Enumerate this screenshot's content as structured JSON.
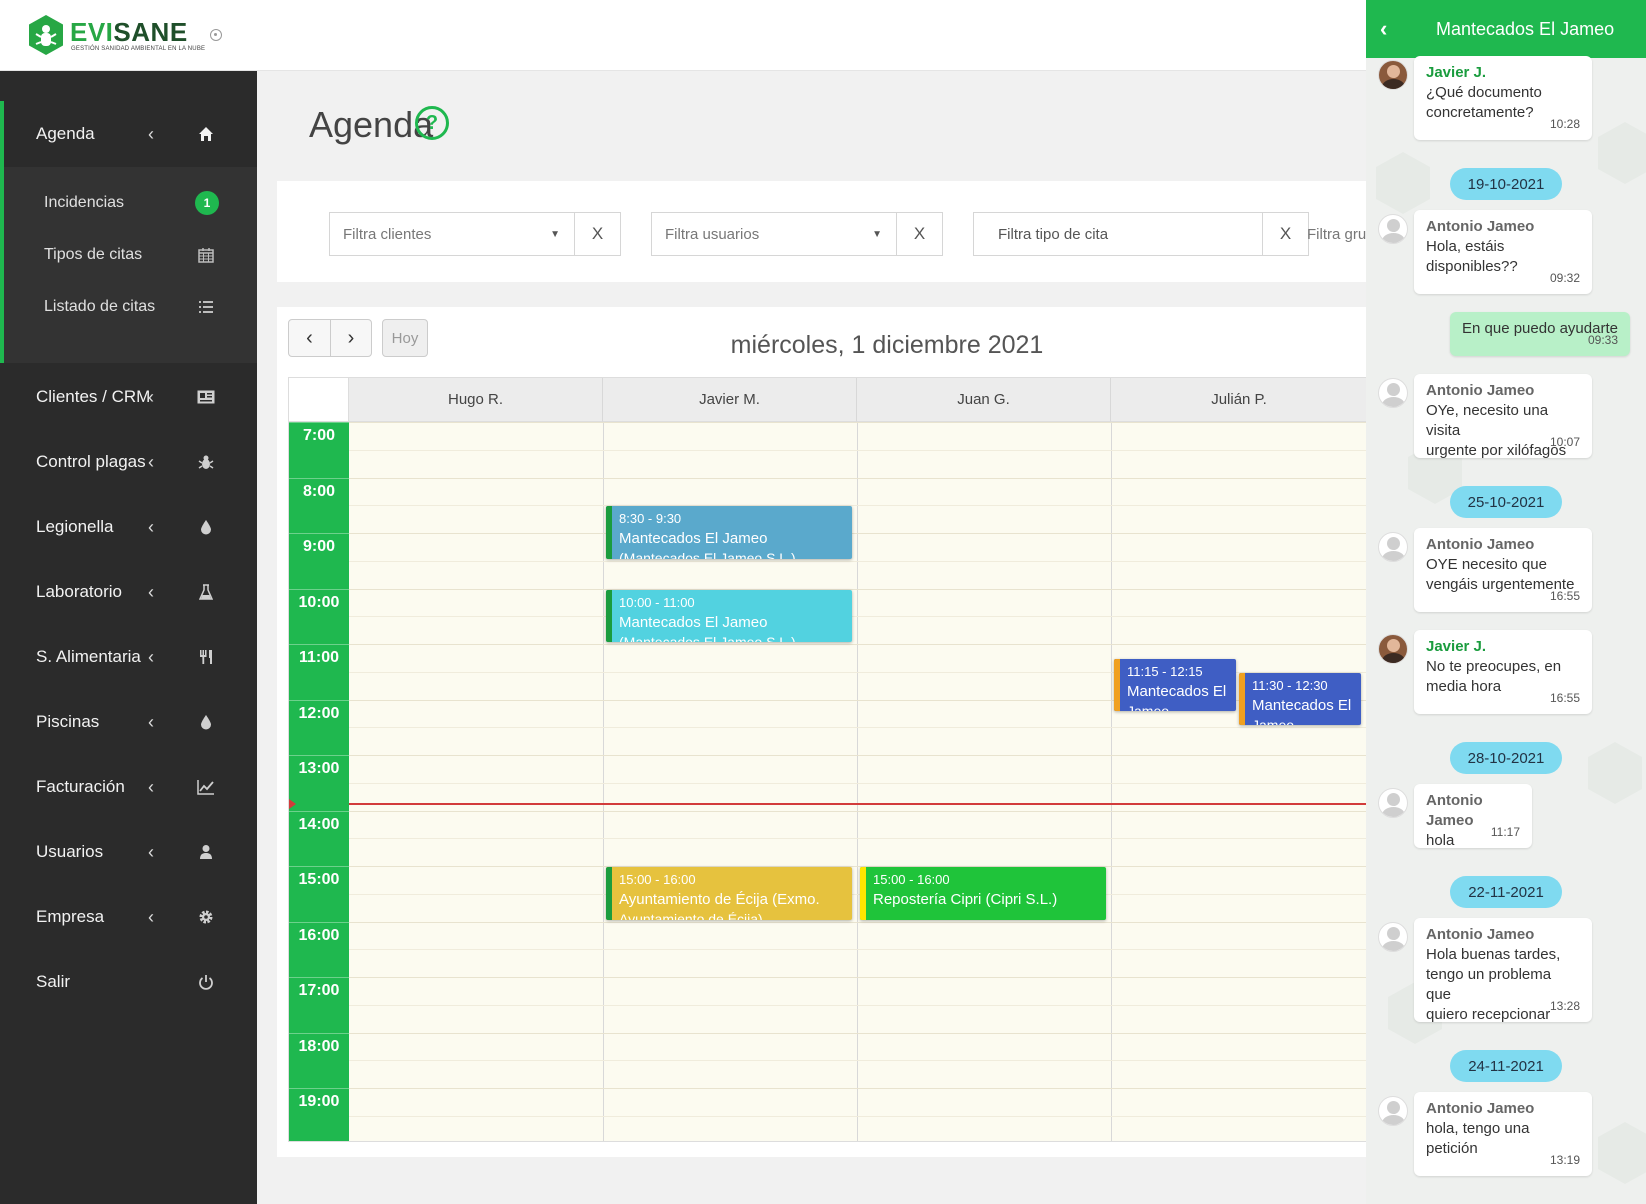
{
  "brand": {
    "name_a": "EVI",
    "name_b": "SANE",
    "tagline": "GESTIÓN SANIDAD AMBIENTAL EN LA NUBE",
    "color": "#27a745"
  },
  "sidebar": {
    "active": {
      "label": "Agenda",
      "chevron": "‹",
      "icon": "home-icon"
    },
    "sub_items": [
      {
        "label": "Incidencias",
        "badge": "1"
      },
      {
        "label": "Tipos de citas",
        "icon": "calendar-icon"
      },
      {
        "label": "Listado de citas",
        "icon": "list-icon"
      }
    ],
    "items": [
      {
        "label": "Clientes / CRM",
        "icon": "id-card-icon"
      },
      {
        "label": "Control plagas",
        "icon": "bug-icon"
      },
      {
        "label": "Legionella",
        "icon": "drop-icon"
      },
      {
        "label": "Laboratorio",
        "icon": "flask-icon"
      },
      {
        "label": "S. Alimentaria",
        "icon": "utensils-icon"
      },
      {
        "label": "Piscinas",
        "icon": "drop-icon"
      },
      {
        "label": "Facturación",
        "icon": "chart-icon"
      },
      {
        "label": "Usuarios",
        "icon": "user-icon"
      },
      {
        "label": "Empresa",
        "icon": "gear-icon"
      },
      {
        "label": "Salir",
        "icon": "power-icon"
      }
    ],
    "chevron": "‹"
  },
  "page": {
    "title": "Agenda",
    "help": "?"
  },
  "filters": {
    "clients_placeholder": "Filtra clientes",
    "users_placeholder": "Filtra usuarios",
    "type_placeholder": "Filtra tipo de cita",
    "group_placeholder": "Filtra gru",
    "clear": "X"
  },
  "calendar": {
    "prev": "‹",
    "next": "›",
    "today": "Hoy",
    "title": "miércoles, 1 diciembre 2021",
    "columns": [
      "Hugo R.",
      "Javier M.",
      "Juan G.",
      "Julián P."
    ],
    "hours": [
      "7:00",
      "8:00",
      "9:00",
      "10:00",
      "11:00",
      "12:00",
      "13:00",
      "14:00",
      "15:00",
      "16:00",
      "17:00",
      "18:00",
      "19:00"
    ],
    "events": [
      {
        "col": 1,
        "start": 8.5,
        "end": 9.5,
        "time": "8:30 - 9:30",
        "title": "Mantecados El Jameo",
        "sub": "(Mantecados El Jameo S.L.)",
        "color": "#5aa9cc",
        "bar": "#1a9c3e"
      },
      {
        "col": 1,
        "start": 10,
        "end": 11,
        "time": "10:00 - 11:00",
        "title": "Mantecados El Jameo",
        "sub": "(Mantecados El Jameo S.L.)",
        "color": "#52d2e0",
        "bar": "#1a9c3e"
      },
      {
        "col": 3,
        "start": 11.25,
        "end": 12.25,
        "time": "11:15 - 12:15",
        "title": "Mantecados El",
        "sub": "Jameo",
        "color": "#3f5ec4",
        "bar": "#f0a020",
        "half": 0
      },
      {
        "col": 3,
        "start": 11.5,
        "end": 12.5,
        "time": "11:30 - 12:30",
        "title": "Mantecados El",
        "sub": "Jameo",
        "color": "#3f5ec4",
        "bar": "#f0a020",
        "half": 1
      },
      {
        "col": 1,
        "start": 15,
        "end": 16,
        "time": "15:00 - 16:00",
        "title": "Ayuntamiento de Écija (Exmo.",
        "sub": "Ayuntamiento de Écija)",
        "color": "#e6c23e",
        "bar": "#1a9c3e"
      },
      {
        "col": 2,
        "start": 15,
        "end": 16,
        "time": "15:00 - 16:00",
        "title": "Repostería Cipri (Cipri S.L.)",
        "sub": "",
        "color": "#1fc43a",
        "bar": "#ffe600"
      }
    ]
  },
  "chat": {
    "back": "‹",
    "title": "Mantecados El Jameo",
    "messages": [
      {
        "kind": "in",
        "who": "Javier J.",
        "me": true,
        "text": "¿Qué documento\nconcretamente?",
        "time": "10:28",
        "photo": true
      },
      {
        "kind": "date",
        "text": "19-10-2021"
      },
      {
        "kind": "in",
        "who": "Antonio Jameo",
        "text": "Hola, estáis\ndisponibles??",
        "time": "09:32"
      },
      {
        "kind": "out",
        "text": "En que puedo ayudarte",
        "time": "09:33"
      },
      {
        "kind": "in",
        "who": "Antonio Jameo",
        "text": "OYe, necesito una visita\nurgente por xilófagos",
        "time": "10:07"
      },
      {
        "kind": "date",
        "text": "25-10-2021"
      },
      {
        "kind": "in",
        "who": "Antonio Jameo",
        "text": "OYE necesito que\nvengáis urgentemente",
        "time": "16:55"
      },
      {
        "kind": "in",
        "who": "Javier J.",
        "me": true,
        "text": "No te preocupes, en\nmedia hora",
        "time": "16:55",
        "photo": true
      },
      {
        "kind": "date",
        "text": "28-10-2021"
      },
      {
        "kind": "in",
        "who": "Antonio Jameo",
        "text": "hola",
        "time": "11:17"
      },
      {
        "kind": "date",
        "text": "22-11-2021"
      },
      {
        "kind": "in",
        "who": "Antonio Jameo",
        "text": "Hola buenas tardes,\ntengo un problema que\nquiero recepcionar",
        "time": "13:28"
      },
      {
        "kind": "date",
        "text": "24-11-2021"
      },
      {
        "kind": "in",
        "who": "Antonio Jameo",
        "text": "hola, tengo una\npetición",
        "time": "13:19"
      }
    ]
  }
}
